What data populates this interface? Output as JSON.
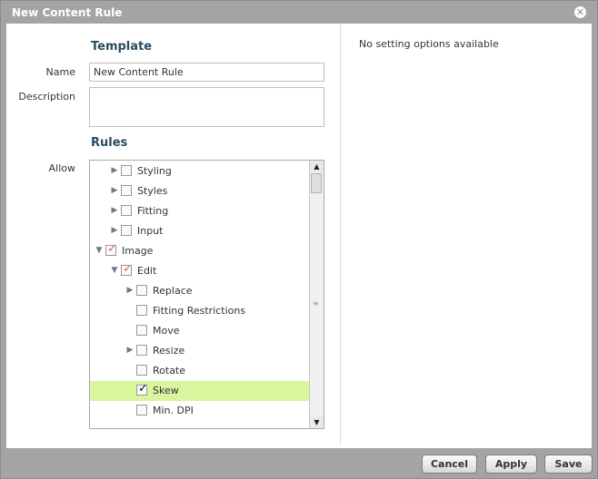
{
  "dialog": {
    "title": "New Content Rule",
    "close_icon": "close-icon"
  },
  "template": {
    "heading": "Template",
    "name_label": "Name",
    "name_value": "New Content Rule",
    "description_label": "Description",
    "description_value": ""
  },
  "rules": {
    "heading": "Rules",
    "allow_label": "Allow",
    "items": [
      {
        "label": "Styling",
        "level": 1,
        "arrow": "right",
        "checked": false,
        "selected": false
      },
      {
        "label": "Styles",
        "level": 1,
        "arrow": "right",
        "checked": false,
        "selected": false
      },
      {
        "label": "Fitting",
        "level": 1,
        "arrow": "right",
        "checked": false,
        "selected": false
      },
      {
        "label": "Input",
        "level": 1,
        "arrow": "right",
        "checked": false,
        "selected": false
      },
      {
        "label": "Image",
        "level": 0,
        "arrow": "down",
        "checked": true,
        "check_style": "partial",
        "selected": false
      },
      {
        "label": "Edit",
        "level": 1,
        "arrow": "down",
        "checked": true,
        "check_style": "partial",
        "selected": false
      },
      {
        "label": "Replace",
        "level": 2,
        "arrow": "right",
        "checked": false,
        "selected": false
      },
      {
        "label": "Fitting Restrictions",
        "level": 2,
        "arrow": "none",
        "checked": false,
        "selected": false
      },
      {
        "label": "Move",
        "level": 2,
        "arrow": "none",
        "checked": false,
        "selected": false
      },
      {
        "label": "Resize",
        "level": 2,
        "arrow": "right",
        "checked": false,
        "selected": false
      },
      {
        "label": "Rotate",
        "level": 2,
        "arrow": "none",
        "checked": false,
        "selected": false
      },
      {
        "label": "Skew",
        "level": 2,
        "arrow": "none",
        "checked": true,
        "check_style": "full",
        "selected": true
      },
      {
        "label": "Min. DPI",
        "level": 2,
        "arrow": "none",
        "checked": false,
        "selected": false
      }
    ]
  },
  "settings": {
    "message": "No setting options available"
  },
  "colors": {
    "selected_row": "#d9f59e",
    "partial_check": "#e8643c",
    "heading": "#294c5f"
  },
  "buttons": {
    "cancel": "Cancel",
    "apply": "Apply",
    "save": "Save"
  }
}
